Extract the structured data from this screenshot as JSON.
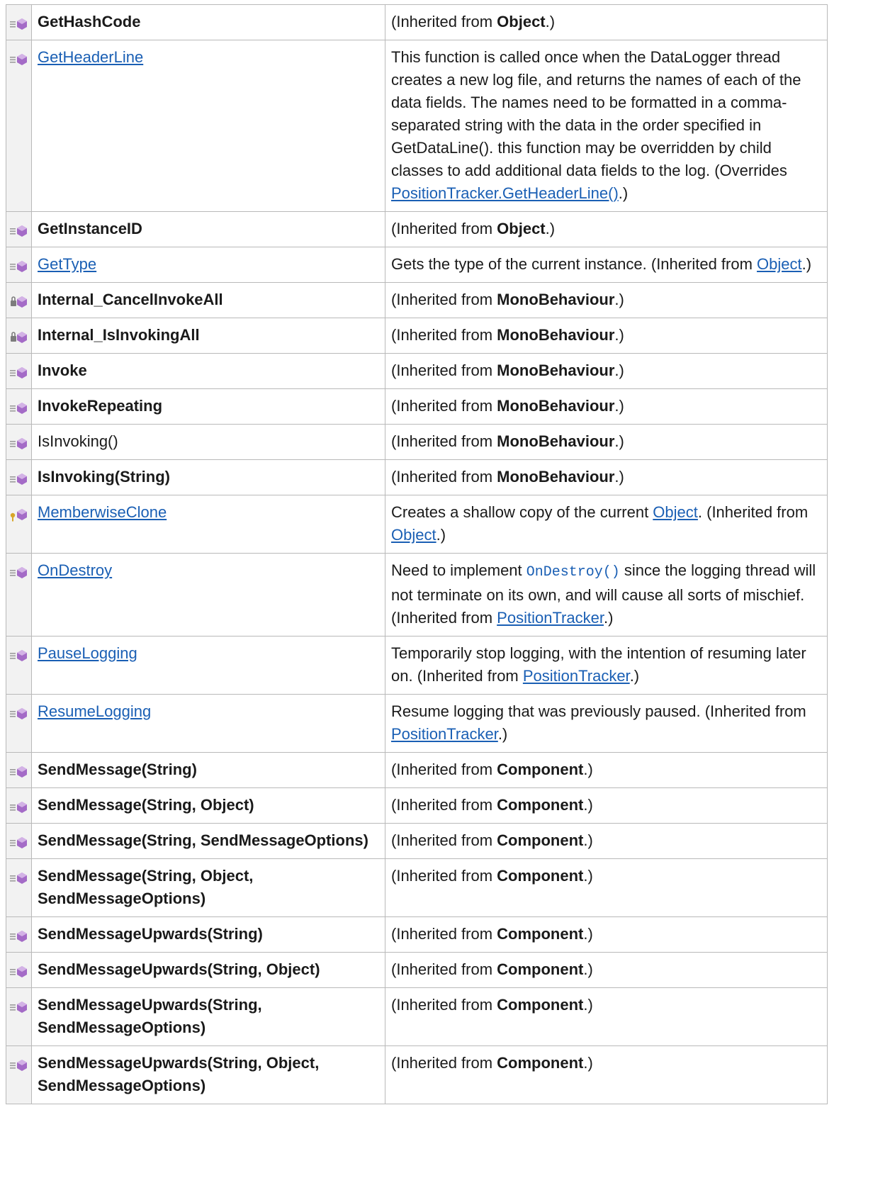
{
  "colors": {
    "link": "#1a5fb4",
    "border": "#b9b9b9",
    "icon_bg": "#f2f2f2",
    "icon_purple": "#a46bc7",
    "icon_lines": "#9c9c9c",
    "icon_key": "#d8a62a",
    "icon_lock": "#7c7c7c"
  },
  "rows": [
    {
      "icon": "public-method-icon",
      "name": "GetHashCode",
      "name_style": "bold",
      "desc": [
        {
          "t": "(Inherited from "
        },
        {
          "t": "Object",
          "s": "bold"
        },
        {
          "t": ".)"
        }
      ]
    },
    {
      "icon": "public-method-icon",
      "name": "GetHeaderLine",
      "name_style": "link",
      "desc": [
        {
          "t": "This function is called once when the DataLogger thread creates a new log file, and returns the names of each of the data fields. The names need to be formatted in a comma-separated string with the data in the order specified in GetDataLine(). this function may be overridden by child classes to add additional data fields to the log. (Overrides "
        },
        {
          "t": "PositionTracker.GetHeaderLine()",
          "s": "link"
        },
        {
          "t": ".)"
        }
      ]
    },
    {
      "icon": "public-method-icon",
      "name": "GetInstanceID",
      "name_style": "bold",
      "desc": [
        {
          "t": "(Inherited from "
        },
        {
          "t": "Object",
          "s": "bold"
        },
        {
          "t": ".)"
        }
      ]
    },
    {
      "icon": "public-method-icon",
      "name": "GetType",
      "name_style": "link",
      "desc": [
        {
          "t": "Gets the type of the current instance. (Inherited from "
        },
        {
          "t": "Object",
          "s": "link"
        },
        {
          "t": ".)"
        }
      ]
    },
    {
      "icon": "private-method-icon",
      "name": "Internal_CancelInvokeAll",
      "name_style": "bold",
      "desc": [
        {
          "t": "(Inherited from "
        },
        {
          "t": "MonoBehaviour",
          "s": "bold"
        },
        {
          "t": ".)"
        }
      ]
    },
    {
      "icon": "private-method-icon",
      "name": "Internal_IsInvokingAll",
      "name_style": "bold",
      "desc": [
        {
          "t": "(Inherited from "
        },
        {
          "t": "MonoBehaviour",
          "s": "bold"
        },
        {
          "t": ".)"
        }
      ]
    },
    {
      "icon": "public-method-icon",
      "name": "Invoke",
      "name_style": "bold",
      "desc": [
        {
          "t": "(Inherited from "
        },
        {
          "t": "MonoBehaviour",
          "s": "bold"
        },
        {
          "t": ".)"
        }
      ]
    },
    {
      "icon": "public-method-icon",
      "name": "InvokeRepeating",
      "name_style": "bold",
      "desc": [
        {
          "t": "(Inherited from "
        },
        {
          "t": "MonoBehaviour",
          "s": "bold"
        },
        {
          "t": ".)"
        }
      ]
    },
    {
      "icon": "public-method-icon",
      "name": "IsInvoking()",
      "name_style": "plain",
      "desc": [
        {
          "t": "(Inherited from "
        },
        {
          "t": "MonoBehaviour",
          "s": "bold"
        },
        {
          "t": ".)"
        }
      ]
    },
    {
      "icon": "public-method-icon",
      "name": "IsInvoking(String)",
      "name_style": "bold",
      "desc": [
        {
          "t": "(Inherited from "
        },
        {
          "t": "MonoBehaviour",
          "s": "bold"
        },
        {
          "t": ".)"
        }
      ]
    },
    {
      "icon": "protected-method-icon",
      "name": "MemberwiseClone",
      "name_style": "link",
      "desc": [
        {
          "t": "Creates a shallow copy of the current "
        },
        {
          "t": "Object",
          "s": "link"
        },
        {
          "t": ". (Inherited from "
        },
        {
          "t": "Object",
          "s": "link"
        },
        {
          "t": ".)"
        }
      ]
    },
    {
      "icon": "public-method-icon",
      "name": "OnDestroy",
      "name_style": "link",
      "desc": [
        {
          "t": "Need to implement "
        },
        {
          "t": "OnDestroy()",
          "s": "code"
        },
        {
          "t": " since the logging thread will not terminate on its own, and will cause all sorts of mischief. (Inherited from "
        },
        {
          "t": "PositionTracker",
          "s": "link"
        },
        {
          "t": ".)"
        }
      ]
    },
    {
      "icon": "public-method-icon",
      "name": "PauseLogging",
      "name_style": "link",
      "desc": [
        {
          "t": "Temporarily stop logging, with the intention of resuming later on. (Inherited from "
        },
        {
          "t": "PositionTracker",
          "s": "link"
        },
        {
          "t": ".)"
        }
      ]
    },
    {
      "icon": "public-method-icon",
      "name": "ResumeLogging",
      "name_style": "link",
      "desc": [
        {
          "t": "Resume logging that was previously paused. (Inherited from "
        },
        {
          "t": "PositionTracker",
          "s": "link"
        },
        {
          "t": ".)"
        }
      ]
    },
    {
      "icon": "public-method-icon",
      "name": "SendMessage(String)",
      "name_style": "bold",
      "desc": [
        {
          "t": "(Inherited from "
        },
        {
          "t": "Component",
          "s": "bold"
        },
        {
          "t": ".)"
        }
      ]
    },
    {
      "icon": "public-method-icon",
      "name": "SendMessage(String, Object)",
      "name_style": "bold",
      "desc": [
        {
          "t": "(Inherited from "
        },
        {
          "t": "Component",
          "s": "bold"
        },
        {
          "t": ".)"
        }
      ]
    },
    {
      "icon": "public-method-icon",
      "name": "SendMessage(String, SendMessageOptions)",
      "name_style": "bold",
      "desc": [
        {
          "t": "(Inherited from "
        },
        {
          "t": "Component",
          "s": "bold"
        },
        {
          "t": ".)"
        }
      ]
    },
    {
      "icon": "public-method-icon",
      "name": "SendMessage(String, Object, SendMessageOptions)",
      "name_style": "bold",
      "desc": [
        {
          "t": "(Inherited from "
        },
        {
          "t": "Component",
          "s": "bold"
        },
        {
          "t": ".)"
        }
      ]
    },
    {
      "icon": "public-method-icon",
      "name": "SendMessageUpwards(String)",
      "name_style": "bold",
      "desc": [
        {
          "t": "(Inherited from "
        },
        {
          "t": "Component",
          "s": "bold"
        },
        {
          "t": ".)"
        }
      ]
    },
    {
      "icon": "public-method-icon",
      "name": "SendMessageUpwards(String, Object)",
      "name_style": "bold",
      "desc": [
        {
          "t": "(Inherited from "
        },
        {
          "t": "Component",
          "s": "bold"
        },
        {
          "t": ".)"
        }
      ]
    },
    {
      "icon": "public-method-icon",
      "name": "SendMessageUpwards(String, SendMessageOptions)",
      "name_style": "bold",
      "desc": [
        {
          "t": "(Inherited from "
        },
        {
          "t": "Component",
          "s": "bold"
        },
        {
          "t": ".)"
        }
      ]
    },
    {
      "icon": "public-method-icon",
      "name": "SendMessageUpwards(String, Object, SendMessageOptions)",
      "name_style": "bold",
      "desc": [
        {
          "t": "(Inherited from "
        },
        {
          "t": "Component",
          "s": "bold"
        },
        {
          "t": ".)"
        }
      ]
    }
  ]
}
